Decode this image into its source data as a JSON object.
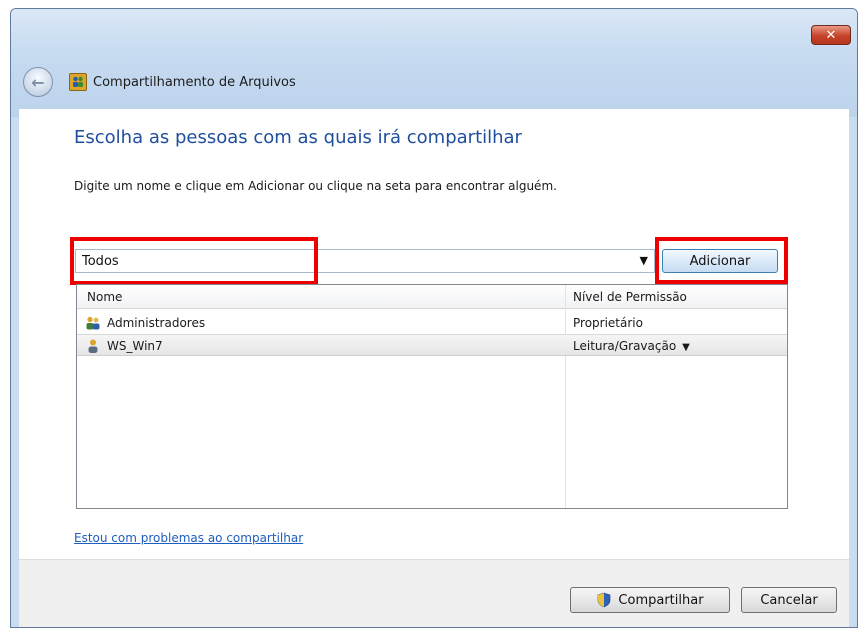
{
  "window": {
    "title": "Compartilhamento de Arquivos",
    "close_label": "✕"
  },
  "main": {
    "heading": "Escolha as pessoas com as quais irá compartilhar",
    "instruction": "Digite um nome e clique em Adicionar ou clique na seta para encontrar alguém.",
    "input_value": "Todos",
    "add_button": "Adicionar"
  },
  "table": {
    "headers": [
      "Nome",
      "Nível de Permissão"
    ],
    "rows": [
      {
        "name": "Administradores",
        "permission": "Proprietário",
        "icon": "group-icon",
        "selected": false
      },
      {
        "name": "WS_Win7",
        "permission": "Leitura/Gravação",
        "icon": "user-icon",
        "selected": true
      }
    ]
  },
  "help_link": "Estou com problemas ao compartilhar",
  "footer": {
    "share_button": "Compartilhar",
    "cancel_button": "Cancelar"
  },
  "colors": {
    "highlight": "#ef0000",
    "heading": "#1f4e9c",
    "link": "#1f5dbf"
  }
}
